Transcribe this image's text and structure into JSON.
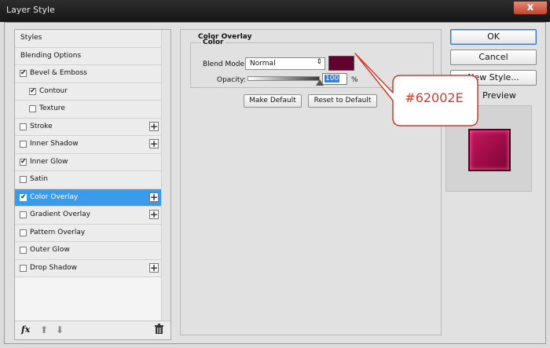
{
  "window": {
    "title": "Layer Style",
    "close_glyph": "x"
  },
  "style_list": {
    "items": [
      {
        "label": "Styles",
        "checkbox": false,
        "checked": false,
        "plus": false,
        "indent": 0
      },
      {
        "label": "Blending Options",
        "checkbox": false,
        "checked": false,
        "plus": false,
        "indent": 0
      },
      {
        "label": "Bevel & Emboss",
        "checkbox": true,
        "checked": true,
        "plus": false,
        "indent": 0
      },
      {
        "label": "Contour",
        "checkbox": true,
        "checked": true,
        "plus": false,
        "indent": 1
      },
      {
        "label": "Texture",
        "checkbox": true,
        "checked": false,
        "plus": false,
        "indent": 1
      },
      {
        "label": "Stroke",
        "checkbox": true,
        "checked": false,
        "plus": true,
        "indent": 0
      },
      {
        "label": "Inner Shadow",
        "checkbox": true,
        "checked": false,
        "plus": true,
        "indent": 0
      },
      {
        "label": "Inner Glow",
        "checkbox": true,
        "checked": true,
        "plus": false,
        "indent": 0
      },
      {
        "label": "Satin",
        "checkbox": true,
        "checked": false,
        "plus": false,
        "indent": 0
      },
      {
        "label": "Color Overlay",
        "checkbox": true,
        "checked": true,
        "plus": true,
        "indent": 0,
        "selected": true
      },
      {
        "label": "Gradient Overlay",
        "checkbox": true,
        "checked": false,
        "plus": true,
        "indent": 0
      },
      {
        "label": "Pattern Overlay",
        "checkbox": true,
        "checked": false,
        "plus": false,
        "indent": 0
      },
      {
        "label": "Outer Glow",
        "checkbox": true,
        "checked": false,
        "plus": false,
        "indent": 0
      },
      {
        "label": "Drop Shadow",
        "checkbox": true,
        "checked": false,
        "plus": true,
        "indent": 0
      }
    ],
    "footer": {
      "fx_label": "fx",
      "up_glyph": "⬆",
      "down_glyph": "⬇"
    }
  },
  "panel": {
    "section_title": "Color Overlay",
    "group_title": "Color",
    "blend_mode_label": "Blend Mode:",
    "blend_mode_value": "Normal",
    "blend_mode_arrow": "⇕",
    "overlay_color": "#62002E",
    "opacity_label": "Opacity:",
    "opacity_value": "100",
    "opacity_fraction": 1.0,
    "opacity_unit": "%",
    "make_default_label": "Make Default",
    "reset_default_label": "Reset to Default"
  },
  "buttons": {
    "ok_label": "OK",
    "cancel_label": "Cancel",
    "new_style_label": "New Style...",
    "preview_label": "Preview",
    "preview_checked": true
  },
  "annotation": {
    "text": "#62002E"
  }
}
